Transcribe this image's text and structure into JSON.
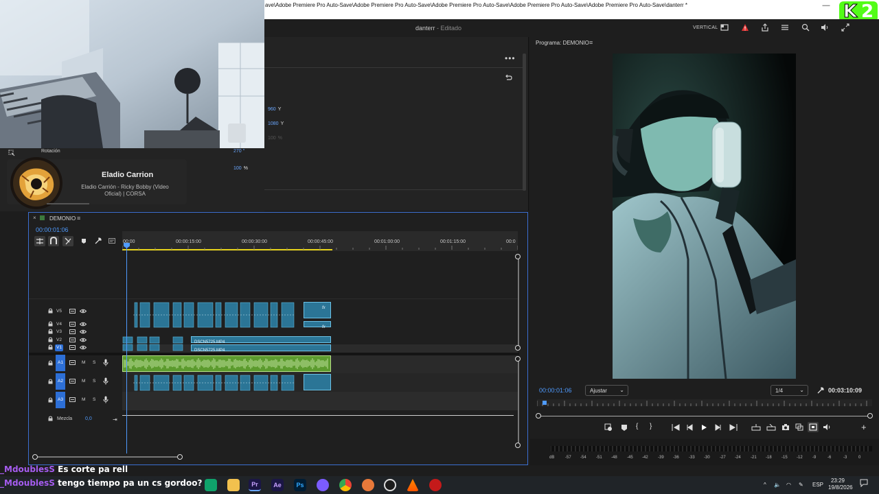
{
  "titlebar": {
    "path": "ave\\Adobe Premiere Pro Auto-Save\\Adobe Premiere Pro Auto-Save\\Adobe Premiere Pro Auto-Save\\Adobe Premiere Pro Auto-Save\\Adobe Premiere Pro Auto-Save\\danterr *",
    "minimize": "—",
    "kick_badge": "2"
  },
  "header": {
    "doc_name": "danterr",
    "doc_status": " - Editado",
    "vertical_label": "VERTICAL"
  },
  "effect_controls": {
    "values": [
      {
        "num": "960",
        "unit": "Y"
      },
      {
        "num": "1080",
        "unit": "Y"
      },
      {
        "num": "100",
        "unit": "%"
      }
    ],
    "rotation_label": "Rotación",
    "rotation_value": "270 °",
    "opacity_value": "100",
    "opacity_unit": "%"
  },
  "music": {
    "artist": "Eladio Carrion",
    "song": "Eladio Carrión - Ricky Bobby (Video Oficial) | CORSA"
  },
  "timeline": {
    "title": "DEMONIO",
    "timecode": "00:00:01:06",
    "ruler": [
      "00:00",
      "00:00:15:00",
      "00:00:30:00",
      "00:00:45:00",
      "00:01:00:00",
      "00:01:15:00",
      "00:0"
    ],
    "video_tracks": [
      "V5",
      "V4",
      "V3",
      "V2",
      "V1"
    ],
    "audio_tracks": [
      "A1",
      "A2",
      "A3"
    ],
    "mix_label": "Mezcla",
    "mix_value": "0,0",
    "clip_v2": "DSCN5725.MP4",
    "clip_v1": "DSCN5725.MP4",
    "fx": "fx",
    "mute": "M",
    "solo": "S"
  },
  "program": {
    "title": "Programa: DEMONIO",
    "timecode_current": "00:00:01:06",
    "fit_option": "Ajustar",
    "resolution": "1/4",
    "timecode_duration": "00:03:10:09"
  },
  "meter": {
    "scale": [
      "dB",
      "-57",
      "-54",
      "-51",
      "-48",
      "-45",
      "-42",
      "-39",
      "-36",
      "-33",
      "-30",
      "-27",
      "-24",
      "-21",
      "-18",
      "-15",
      "-12",
      "-9",
      "-6",
      "-3",
      "0"
    ]
  },
  "chat": [
    {
      "user": "_MdoublesS",
      "message": "Es corte pa rell"
    },
    {
      "user": "_MdoublesS",
      "message": "tengo tiempo pa un cs gordoo?"
    }
  ],
  "taskbar": {
    "language": "ESP",
    "time": "23:29",
    "date": "19/8/2026"
  },
  "colors": {
    "accent": "#4f9bff",
    "clip_video": "#2b7596",
    "clip_audio": "#5c9b2e",
    "chat_user": "#a65cf0",
    "kick": "#53fc18"
  }
}
